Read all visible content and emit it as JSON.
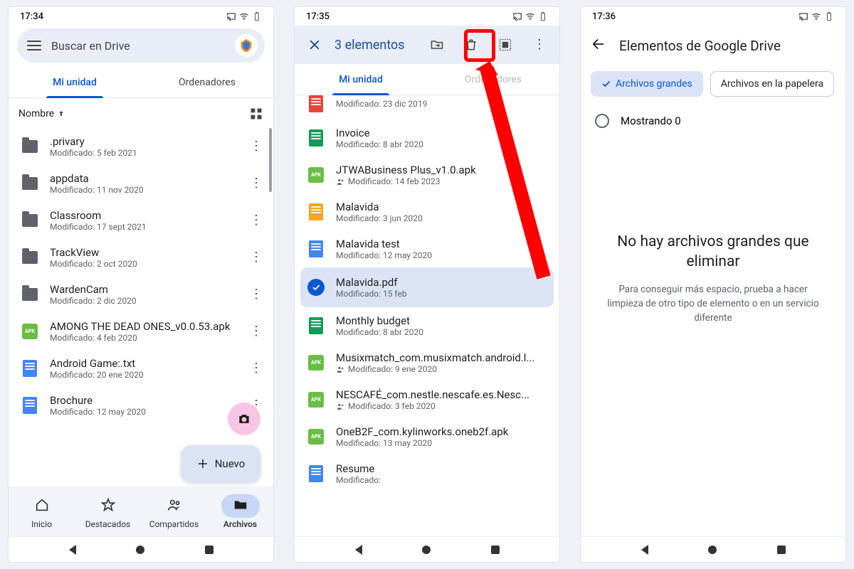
{
  "s1": {
    "time": "17:34",
    "search_placeholder": "Buscar en Drive",
    "tab_my": "Mi unidad",
    "tab_pc": "Ordenadores",
    "sort": "Nombre",
    "mod_prefix": "Modificado: ",
    "new_btn": "Nuevo",
    "files": [
      {
        "name": ".privary",
        "meta": "5 feb 2021",
        "type": "folder"
      },
      {
        "name": "appdata",
        "meta": "11 nov 2020",
        "type": "folder"
      },
      {
        "name": "Classroom",
        "meta": "17 sept 2021",
        "type": "folder"
      },
      {
        "name": "TrackView",
        "meta": "2 oct 2020",
        "type": "folder"
      },
      {
        "name": "WardenCam",
        "meta": "2 dic 2020",
        "type": "folder"
      },
      {
        "name": "AMONG THE DEAD ONES_v0.0.53.apk",
        "meta": "4 feb 2020",
        "type": "apk"
      },
      {
        "name": "Android Game:.txt",
        "meta": "20 ene 2020",
        "type": "doc-blue"
      },
      {
        "name": "Brochure",
        "meta": "12 may 2020",
        "type": "doc-blue"
      }
    ],
    "nav": {
      "home": "Inicio",
      "starred": "Destacados",
      "shared": "Compartidos",
      "files": "Archivos"
    }
  },
  "s2": {
    "time": "17:35",
    "sel_title": "3 elementos",
    "tab_my": "Mi unidad",
    "tab_pc": "Ordenadores",
    "mod_prefix": "Modificado: ",
    "files": [
      {
        "name": "",
        "meta": "23 dic 2019",
        "type": "doc-red",
        "shared": false,
        "partial": true
      },
      {
        "name": "Invoice",
        "meta": "8 abr 2020",
        "type": "doc-green",
        "shared": false
      },
      {
        "name": "JTWABusiness Plus_v1.0.apk",
        "meta": "14 feb 2023",
        "type": "apk",
        "shared": true
      },
      {
        "name": "Malavida",
        "meta": "3 jun 2020",
        "type": "doc-orange",
        "shared": false
      },
      {
        "name": "Malavida test",
        "meta": "12 may 2020",
        "type": "doc-blue",
        "shared": false
      },
      {
        "name": "Malavida.pdf",
        "meta": "15 feb",
        "type": "selected",
        "shared": false
      },
      {
        "name": "Monthly budget",
        "meta": "8 abr 2020",
        "type": "doc-green",
        "shared": false
      },
      {
        "name": "Musixmatch_com.musixmatch.android.l...",
        "meta": "9 ene 2020",
        "type": "apk",
        "shared": true
      },
      {
        "name": "NESCAFÉ_com.nestle.nescafe.es.Nesc...",
        "meta": "3 feb 2020",
        "type": "apk",
        "shared": true
      },
      {
        "name": "OneB2F_com.kylinworks.oneb2f.apk",
        "meta": "13 may 2020",
        "type": "apk",
        "shared": false
      },
      {
        "name": "Resume",
        "meta": "",
        "type": "doc-blue",
        "shared": false
      }
    ]
  },
  "s3": {
    "time": "17:36",
    "title": "Elementos de Google Drive",
    "chip_large": "Archivos grandes",
    "chip_trash": "Archivos en la papelera",
    "showing": "Mostrando 0",
    "empty_h": "No hay archivos grandes que eliminar",
    "empty_p": "Para conseguir más espacio, prueba a hacer limpieza de otro tipo de elemento o en un servicio diferente"
  }
}
